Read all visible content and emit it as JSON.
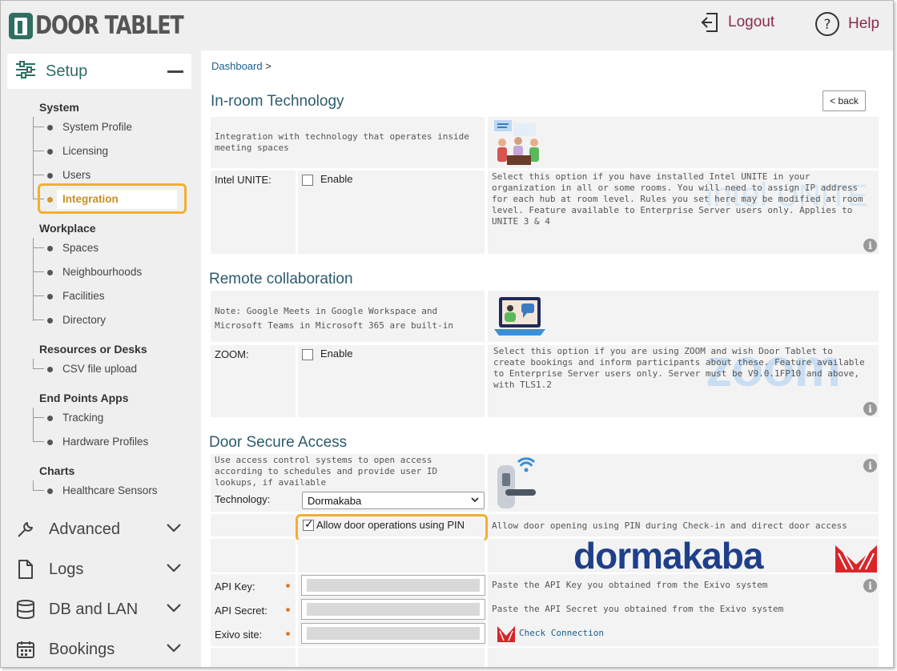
{
  "header": {
    "logo_text": "DOOR TABLET",
    "logout_label": "Logout",
    "help_label": "Help"
  },
  "sidebar": {
    "setup_label": "Setup",
    "groups": [
      {
        "title": "System",
        "items": [
          "System Profile",
          "Licensing",
          "Users",
          "Integration"
        ]
      },
      {
        "title": "Workplace",
        "items": [
          "Spaces",
          "Neighbourhoods",
          "Facilities",
          "Directory"
        ]
      },
      {
        "title": "Resources or Desks",
        "items": [
          "CSV file upload"
        ]
      },
      {
        "title": "End Points Apps",
        "items": [
          "Tracking",
          "Hardware Profiles"
        ]
      },
      {
        "title": "Charts",
        "items": [
          "Healthcare Sensors"
        ]
      }
    ],
    "active_item": "Integration",
    "sections": [
      "Advanced",
      "Logs",
      "DB and LAN",
      "Bookings"
    ]
  },
  "main": {
    "breadcrumb": "Dashboard",
    "breadcrumb_sep": ">",
    "back_label": "< back",
    "inroom": {
      "title": "In-room Technology",
      "intro": "Integration with technology that operates inside meeting spaces",
      "row_label": "Intel UNITE:",
      "enable_label": "Enable",
      "description": "Select this option if you have installed Intel UNITE in your organization in all or some rooms.  You will need to assign IP address for each hub at room level. Rules you set here may be modified at room level. Feature available to Enterprise Server users only. Applies to UNITE 3 & 4",
      "logo_intel": "intel",
      "logo_unite": "UNITE"
    },
    "remote": {
      "title": "Remote collaboration",
      "note": "Note: Google Meets in Google Workspace and Microsoft Teams in Microsoft 365 are built-in",
      "row_label": "ZOOM:",
      "enable_label": "Enable",
      "description": "Select this option if you are using ZOOM and wish Door Tablet to create bookings and inform participants about these.  Feature available to Enterprise Server users only. Server must be V9.0.1FP10 and above, with TLS1.2",
      "logo_zoom": "zoom"
    },
    "door": {
      "title": "Door Secure Access",
      "intro": "Use access control systems to open access according to schedules and provide user ID lookups, if available",
      "technology_label": "Technology:",
      "technology_value": "Dormakaba",
      "pin_label": "Allow door operations using PIN",
      "pin_checked": true,
      "pin_description": "Allow door opening using PIN during Check-in and direct door access",
      "brand_logo": "dormakaba",
      "api_key_label": "API Key:",
      "api_key_help": "Paste the API Key you obtained from the Exivo system",
      "api_secret_label": "API Secret:",
      "api_secret_help": "Paste the API Secret you obtained from the Exivo system",
      "exivo_label": "Exivo site:",
      "check_connection": "Check Connection"
    },
    "info_glyph": "i"
  },
  "colors": {
    "brand_green": "#2f6e63",
    "link_maroon": "#8b2b4f",
    "highlight": "#f0b030",
    "section_title": "#2c5b6f",
    "dormakaba_blue": "#1e3f8a",
    "dormakaba_red": "#d9252a"
  }
}
